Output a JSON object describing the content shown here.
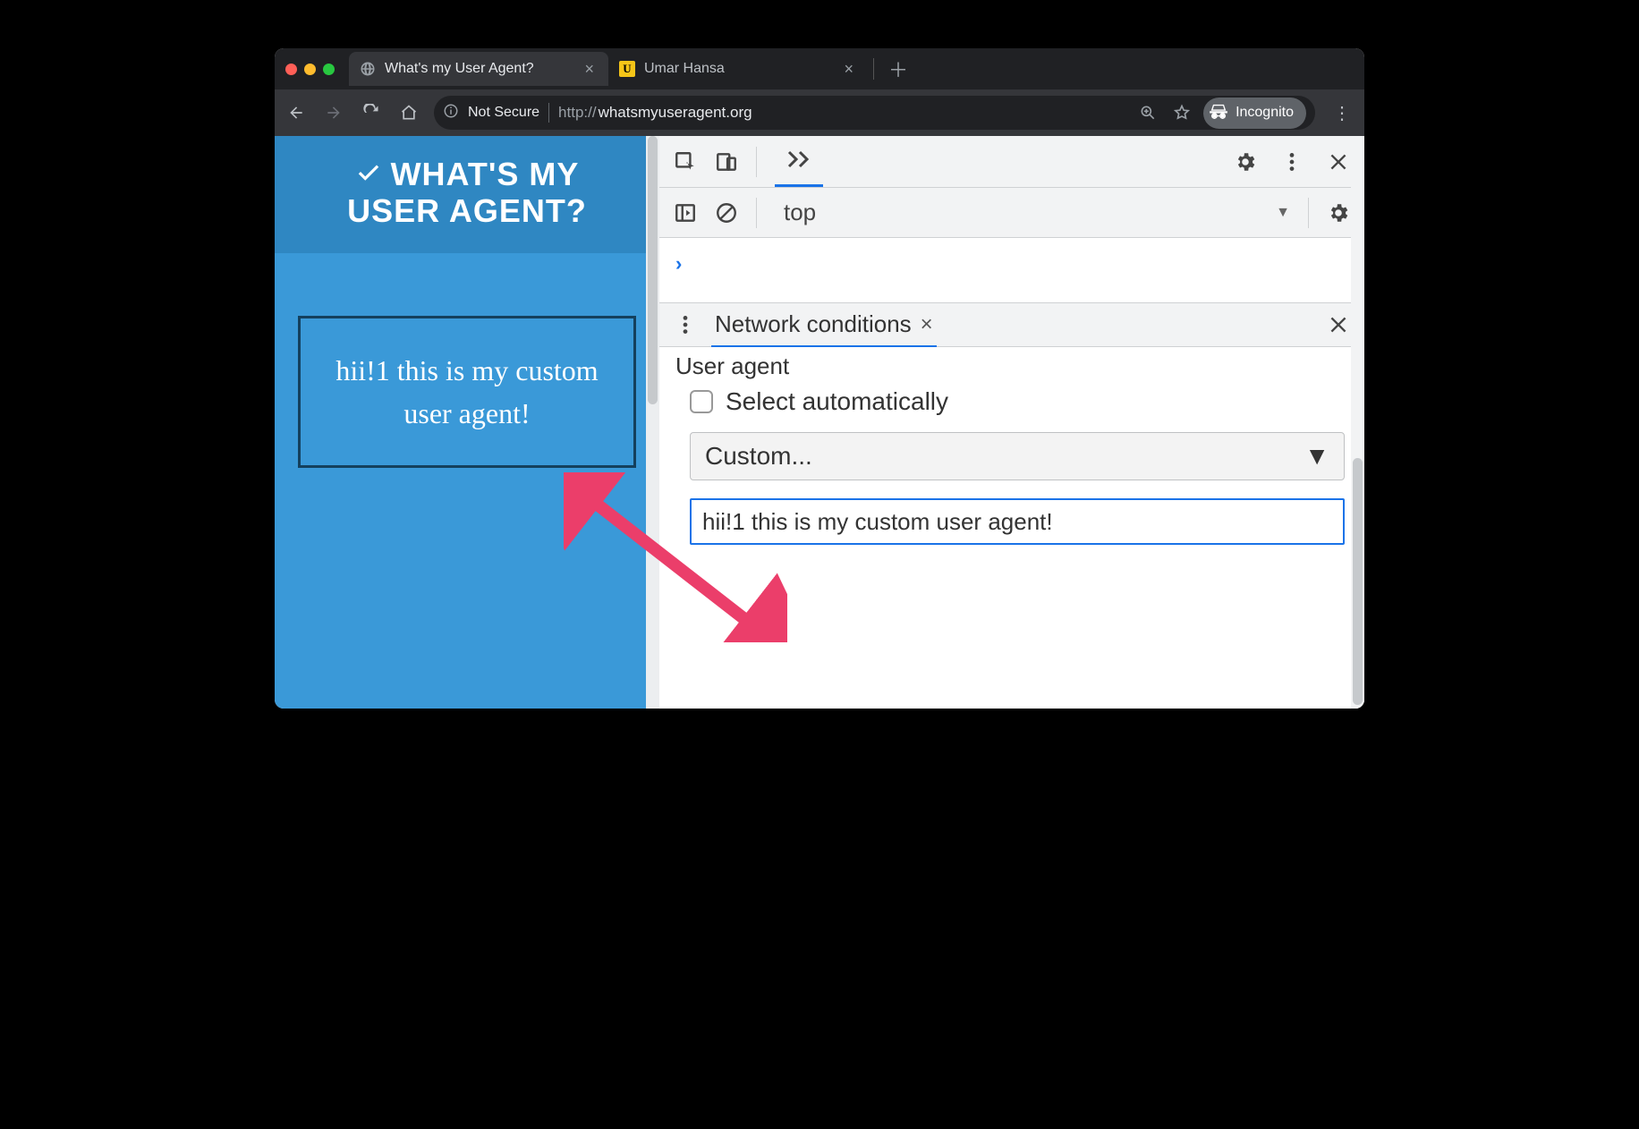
{
  "tabs": {
    "tab1": {
      "title": "What's my User Agent?"
    },
    "tab2": {
      "title": "Umar Hansa",
      "favicon_letter": "U"
    }
  },
  "omnibox": {
    "not_secure": "Not Secure",
    "protocol": "http://",
    "host": "whatsmyuseragent.org"
  },
  "incognito_label": "Incognito",
  "page": {
    "title_line1": "WHAT'S MY",
    "title_line2": "USER AGENT?",
    "detected_ua": "hii!1 this is my custom user agent!"
  },
  "devtools": {
    "context": "top",
    "drawer_tab": "Network conditions",
    "section_title": "User agent",
    "auto_label": "Select automatically",
    "preset": "Custom...",
    "ua_input": "hii!1 this is my custom user agent!"
  }
}
